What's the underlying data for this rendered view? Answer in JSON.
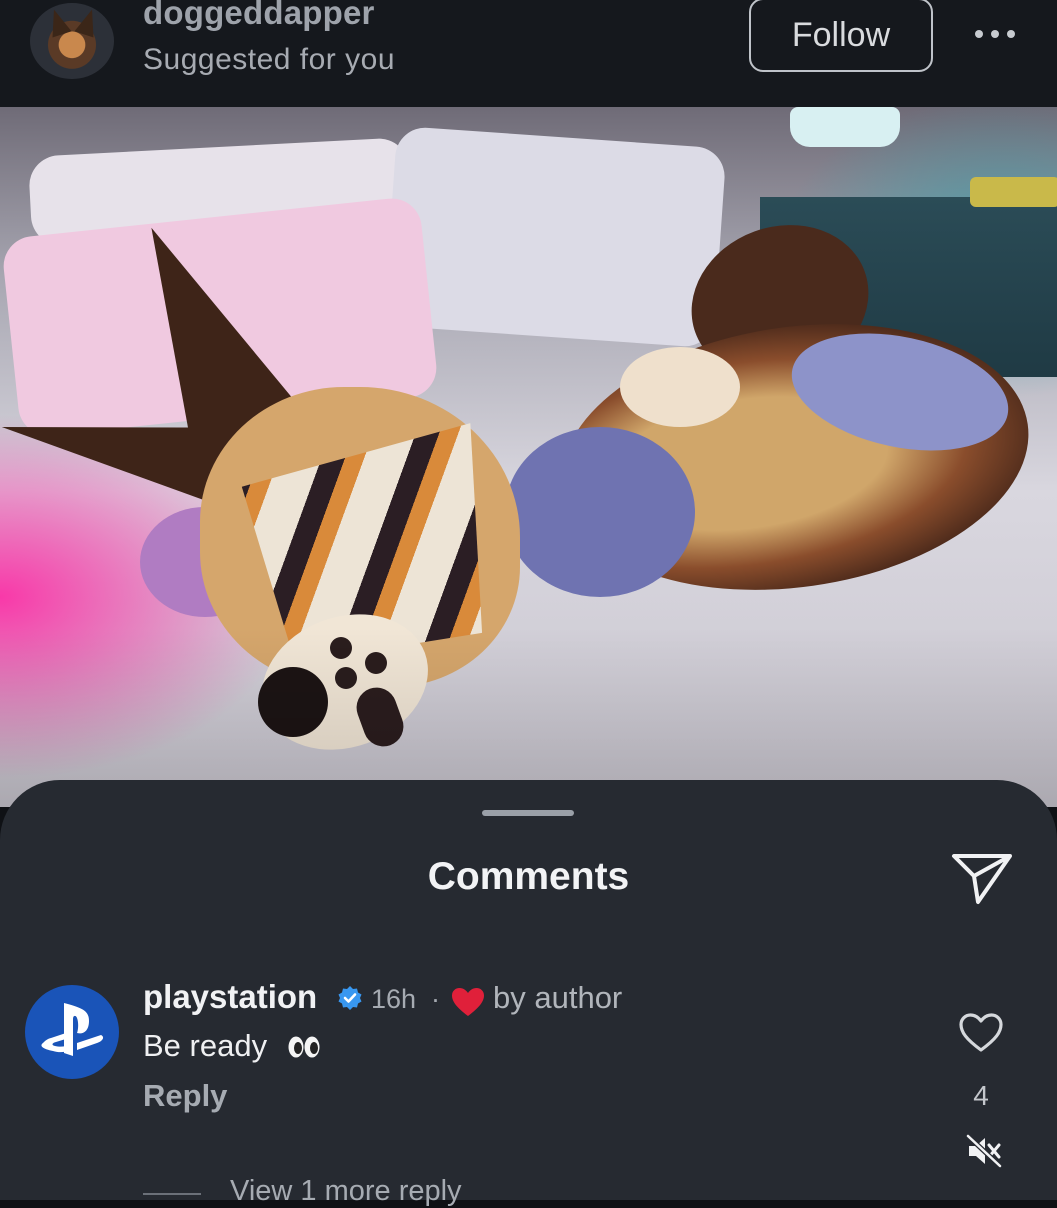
{
  "post_header": {
    "username": "doggeddapper",
    "subtitle": "Suggested for you",
    "follow_label": "Follow",
    "more_icon": "more-horizontal-icon"
  },
  "comments_sheet": {
    "title": "Comments",
    "share_icon": "send-icon",
    "comments": [
      {
        "username": "playstation",
        "verified": true,
        "time": "16h",
        "separator": "·",
        "liked_by_author_label": "by author",
        "text": "Be ready",
        "text_emoji": "eyes-emoji",
        "reply_label": "Reply",
        "like_count": "4",
        "view_replies_label": "View 1 more reply"
      }
    ]
  },
  "colors": {
    "sheet_bg": "#262a31",
    "header_bg": "#15181d",
    "playstation_blue": "#1a54b8",
    "verified_blue": "#3897f0",
    "heart_red": "#e0203a"
  }
}
